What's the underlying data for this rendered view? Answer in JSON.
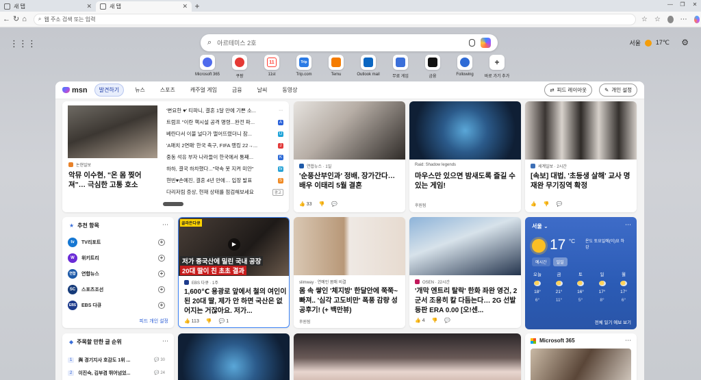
{
  "browser": {
    "tabs": [
      {
        "title": "새 탭"
      },
      {
        "title": "새 탭"
      }
    ],
    "address_placeholder": "웹 주소 검색 또는 입력",
    "copilot_label": "채팅"
  },
  "search": {
    "placeholder": "아르테미스 2호"
  },
  "weather_top": {
    "city": "서울",
    "temp": "17",
    "unit": "℃"
  },
  "quicklinks": [
    {
      "label": "Microsoft 365",
      "icon": "microsoft365-icon",
      "color": "#4f6bed"
    },
    {
      "label": "쿠팡",
      "icon": "coupang-icon",
      "color": "#e53935"
    },
    {
      "label": "11st",
      "icon": "11st-icon",
      "color": "#ff3b30"
    },
    {
      "label": "Trip.com",
      "icon": "tripcom-icon",
      "color": "#2c7be5"
    },
    {
      "label": "Temu",
      "icon": "temu-icon",
      "color": "#f57c00"
    },
    {
      "label": "Outlook mail",
      "icon": "outlook-icon",
      "color": "#0a66c2"
    },
    {
      "label": "무료 게임",
      "icon": "games-icon",
      "color": "#3b6fd9"
    },
    {
      "label": "금융",
      "icon": "finance-icon",
      "color": "#111111"
    },
    {
      "label": "Following",
      "icon": "following-icon",
      "color": "#2f6bd6"
    },
    {
      "label": "바로 가기 추가",
      "icon": "plus-icon",
      "color": "#ffffff"
    }
  ],
  "feed": {
    "logo": "msn",
    "tabs": [
      "발견하기",
      "뉴스",
      "스포츠",
      "캐주얼 게임",
      "금융",
      "날씨",
      "동영상"
    ],
    "layout_btn": "피드 레이아웃",
    "settings_btn": "개인 설정"
  },
  "hero": {
    "source": "논현일보",
    "headline": "악뮤 이수현, \"온 몸 찢어져\"… 극심한 고통 호소",
    "list": [
      {
        "text": "'변요한 ♥' 티파니, 결혼 1달 만에 기쁜 소...",
        "icon": "more-icon",
        "color": "#888888"
      },
      {
        "text": "트럼프 \"이란 핵시설 공격 명령...완전 파...",
        "icon": "news-a-icon",
        "color": "#2b62d9"
      },
      {
        "text": "베란다서 이불 널다가 떨어뜨렸더니 잠...",
        "icon": "news-u-icon",
        "color": "#1fa3d8"
      },
      {
        "text": "'A매치 2연패' 한국 축구, FIFA 랭킹 22→...",
        "icon": "news-j-icon",
        "color": "#e23b3b"
      },
      {
        "text": "중동 석유 부자 나라들이 한국에서 통째...",
        "icon": "news-k-icon",
        "color": "#2d6ad6"
      },
      {
        "text": "하하, 결국 하차했다...\"약속 못 지켜 미안\"",
        "icon": "news-tv-icon",
        "color": "#29a3d6"
      },
      {
        "text": "현빈♥손예진, 결혼 4년 만에… 입장 발표",
        "icon": "news-s-icon",
        "color": "#f08a24"
      },
      {
        "text": "다리저림 증상, 현재 상태를 점검해보세요",
        "icon": "ad-badge",
        "color": "#999999"
      }
    ],
    "ad_label": "광고"
  },
  "cards": [
    {
      "source": "연합뉴스 · 1일",
      "headline": "'순풍산부인과' 정배, 장가간다… 배우 이태리 5월 결혼",
      "likes": "33"
    },
    {
      "source": "Raid: Shadow legends",
      "headline": "마우스만 있으면 밤새도록 즐길 수 있는 게임!",
      "promo": "후원됨"
    },
    {
      "source": "세계일보 · 2시간",
      "headline": "[속보] 대법, '초등생 살해' 교사 명재완 무기징역 확정"
    },
    {
      "source": "EBS 다큐 · 1주",
      "headline": "1,600℃ 용광로 앞에서 철의 여인이 된 20대 딸, 제가 안 하면 국산은 없어지는 거잖아요. 저가...",
      "likes": "113",
      "comments": "1",
      "overlay": "저가 중국산에 밀린 국내 공장",
      "overlay2": "20대 딸이 친 초초 결과",
      "tag": "골라든다큐"
    },
    {
      "source": "slimway · 연예인 몸매 비결",
      "headline": "몸 속 쌓인 '체지방' 한달안에 쭉쭉~ 빠져.. '심각 고도비만' 폭풍 감량 성공후기! (+ 백만뷰)",
      "promo": "후원됨"
    },
    {
      "source": "OSEN · 22시간",
      "headline": "'개막 엔트리 탈락' 한화 좌완 영건, 2군서 조용히 칼 다듬는다… 2G 선발 등판 ERA 0.00 [오!센...",
      "likes": "4"
    }
  ],
  "following": {
    "title": "추천 항목",
    "items": [
      {
        "name": "TV리포트",
        "short": "tv",
        "color": "#1677d2"
      },
      {
        "name": "위키트리",
        "short": "W",
        "color": "#6a2bd6"
      },
      {
        "name": "연합뉴스",
        "short": "연합",
        "color": "#1e5aa8"
      },
      {
        "name": "스포츠조선",
        "short": "SC",
        "color": "#163b7a"
      },
      {
        "name": "EBS 다큐",
        "short": "EBS",
        "color": "#1d3b8c"
      }
    ],
    "footer": "피드 개인 설정"
  },
  "weather": {
    "city": "서울",
    "temp": "17",
    "unit": "°C",
    "summary": "온도 토요일에(이)요 하강",
    "tabs": [
      "예시간",
      "일일"
    ],
    "days": [
      {
        "label": "오늘",
        "hi": "18°",
        "lo": "6°"
      },
      {
        "label": "금",
        "hi": "21°",
        "lo": "11°"
      },
      {
        "label": "토",
        "hi": "16°",
        "lo": "5°"
      },
      {
        "label": "일",
        "hi": "17°",
        "lo": "8°"
      },
      {
        "label": "월",
        "hi": "17°",
        "lo": "6°"
      }
    ],
    "footer": "전체 일기 예보 보기"
  },
  "trending": {
    "title": "주목할 만한 글 순위",
    "items": [
      {
        "rank": "1",
        "text": "與 경기지사 호감도 1위 ...",
        "count": "30"
      },
      {
        "rank": "2",
        "text": "이진숙, 김부겸 뛰어넘었...",
        "count": "24"
      }
    ]
  },
  "m365": {
    "title": "Microsoft 365"
  }
}
